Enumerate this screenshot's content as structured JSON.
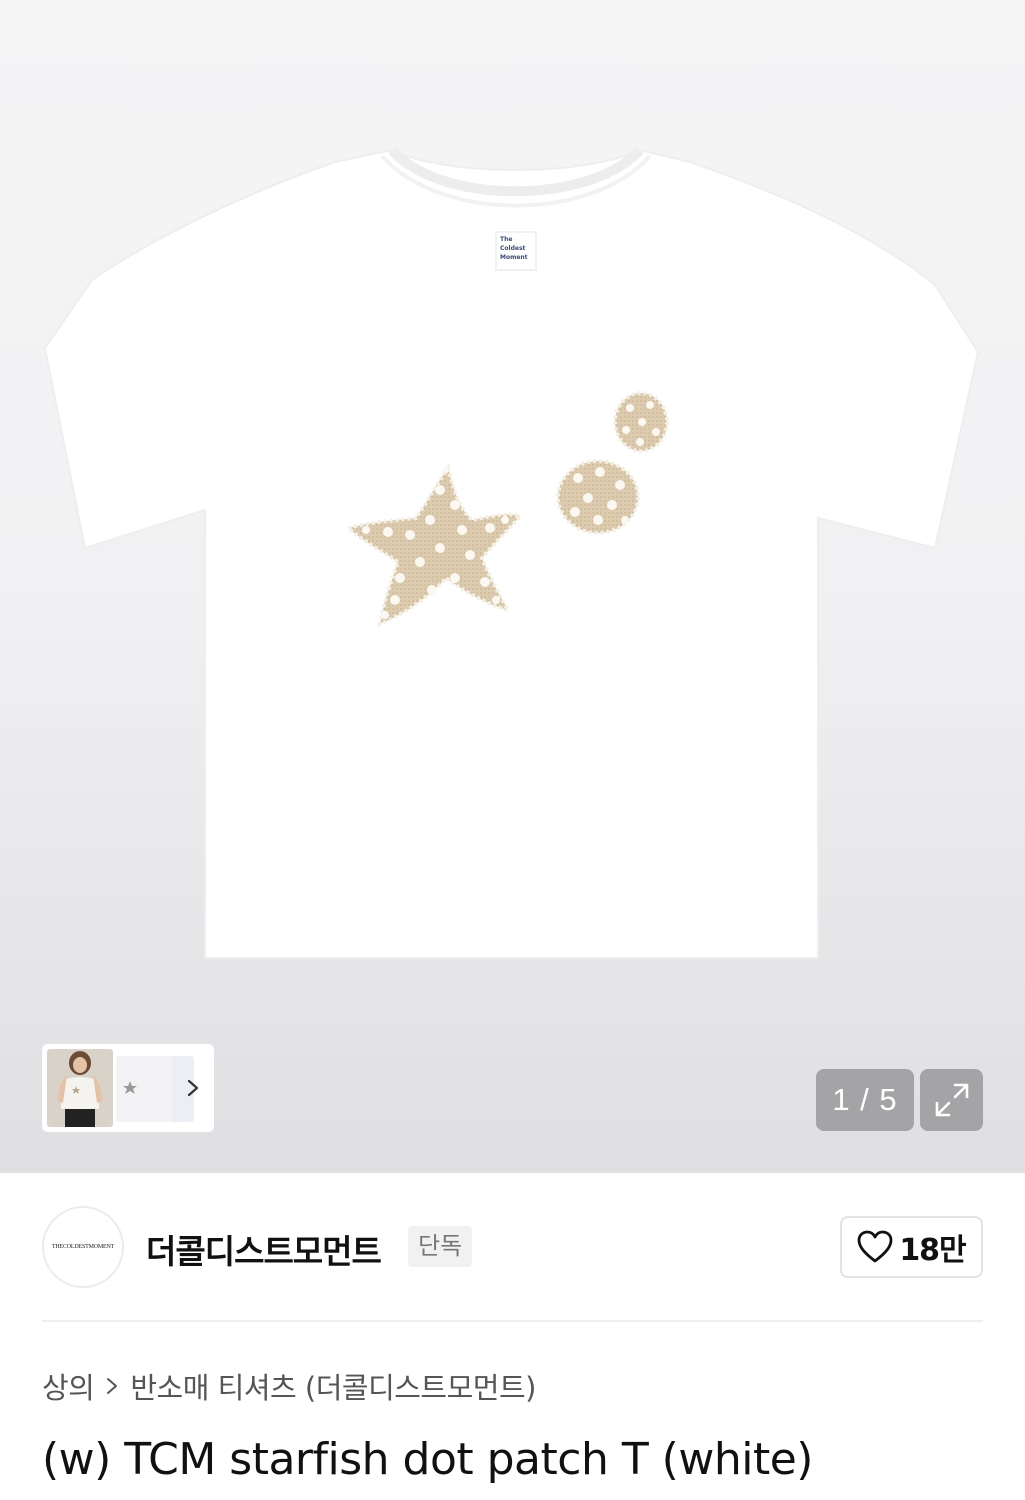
{
  "gallery": {
    "page_current": "1",
    "page_total": "5",
    "counter_text": "1 / 5",
    "tag_text": [
      "The",
      "Coldest",
      "Moment"
    ]
  },
  "brand": {
    "logo_text": "THECOLDESTMOMENT",
    "name": "더콜디스트모먼트",
    "badge": "단독",
    "like_count": "18만"
  },
  "breadcrumb": {
    "category": "상의",
    "subcategory": "반소매 티셔츠 (더콜디스트모먼트)"
  },
  "product": {
    "title": "(w) TCM starfish dot patch T (white)"
  },
  "icons": {
    "thumb_next": "chevron-right-icon",
    "expand": "expand-arrows-icon",
    "like": "heart-outline-icon",
    "crumb_sep": "chevron-right-icon"
  },
  "colors": {
    "patch": "#d9c9ad",
    "counter_bg": "#969698"
  }
}
